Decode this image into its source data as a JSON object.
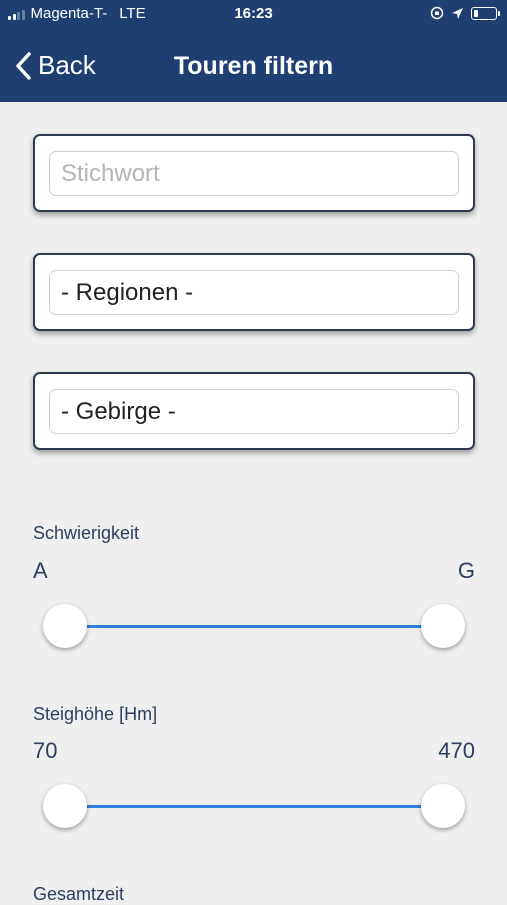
{
  "status_bar": {
    "carrier": "Magenta-T-",
    "network": "LTE",
    "time": "16:23"
  },
  "nav": {
    "back_label": "Back",
    "title": "Touren filtern"
  },
  "filters": {
    "keyword_placeholder": "Stichwort",
    "region_value": "- Regionen -",
    "mountain_value": "- Gebirge -"
  },
  "difficulty": {
    "label": "Schwierigkeit",
    "min_label": "A",
    "max_label": "G",
    "range_fraction": [
      0,
      1
    ]
  },
  "ascent": {
    "label": "Steighöhe [Hm]",
    "min_value": "70",
    "max_value": "470",
    "range_fraction": [
      0,
      1
    ]
  },
  "total_time": {
    "label": "Gesamtzeit"
  },
  "colors": {
    "header": "#1f3f73",
    "accent": "#2f7fd8",
    "background": "#efefef"
  }
}
